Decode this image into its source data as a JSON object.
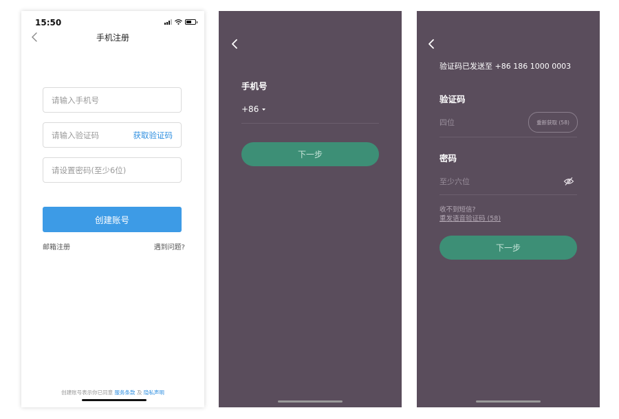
{
  "phone1": {
    "status_time": "15:50",
    "title": "手机注册",
    "phone_placeholder": "请输入手机号",
    "code_placeholder": "请输入验证码",
    "get_code_link": "获取验证码",
    "password_placeholder": "请设置密码(至少6位)",
    "create_button": "创建账号",
    "email_register_link": "邮箱注册",
    "help_link": "遇到问题?",
    "footer_prefix": "创建账号表示你已同意",
    "terms_link": "服务条款",
    "footer_and": "及",
    "privacy_link": "隐私声明"
  },
  "phone2": {
    "phone_label": "手机号",
    "country_code": "+86",
    "next_button": "下一步"
  },
  "phone3": {
    "sent_message": "验证码已发送至 +86 186 1000 0003",
    "code_label": "验证码",
    "code_placeholder": "四位",
    "resend_button": "重新获取 (58)",
    "password_label": "密码",
    "password_placeholder": "至少六位",
    "no_sms_text": "收不到短信?",
    "voice_code_link": "重发语音验证码 (58)",
    "next_button": "下一步"
  },
  "colors": {
    "dark_background": "#5a4d5c",
    "green_button": "#3d8f76",
    "blue_button": "#3d9be6",
    "link_blue": "#2f8fe0"
  },
  "icons": [
    "back-chevron-icon",
    "signal-icon",
    "wifi-icon",
    "battery-icon",
    "dropdown-caret-icon",
    "eye-off-icon"
  ]
}
